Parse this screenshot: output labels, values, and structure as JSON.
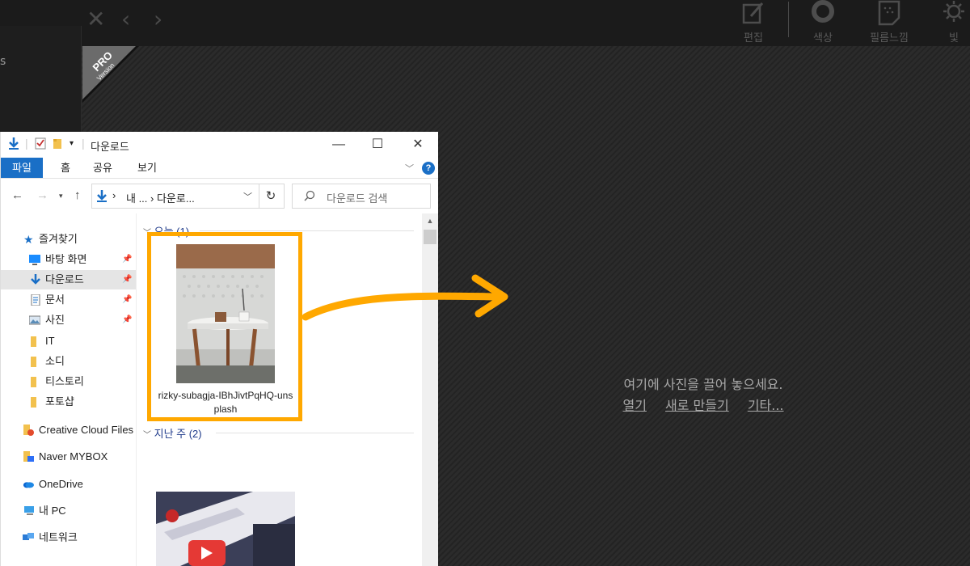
{
  "editor": {
    "tools": [
      {
        "icon": "edit-icon",
        "label": "편집"
      },
      {
        "icon": "color-icon",
        "label": "색상"
      },
      {
        "icon": "film-grain-icon",
        "label": "필름느낌"
      },
      {
        "icon": "light-icon",
        "label": "빛"
      }
    ],
    "left_panel_fragment": "s",
    "pro_badge": {
      "line1": "PRO",
      "line2": "Version"
    },
    "drop_hint": "여기에 사진을 끌어 놓으세요.",
    "links": {
      "open": "열기",
      "new": "새로 만들기",
      "more": "기타..."
    }
  },
  "explorer": {
    "title": "다운로드",
    "ribbon_tabs": [
      "파일",
      "홈",
      "공유",
      "보기"
    ],
    "help": "?",
    "address": "내 ... › 다운로...",
    "address_prefix": "›",
    "search_placeholder": "다운로드 검색",
    "nav": [
      {
        "label": "즐겨찾기",
        "icon": "star-icon"
      },
      {
        "label": "바탕 화면",
        "icon": "desktop-icon",
        "pinned": true
      },
      {
        "label": "다운로드",
        "icon": "download-icon",
        "pinned": true,
        "selected": true
      },
      {
        "label": "문서",
        "icon": "document-icon",
        "pinned": true
      },
      {
        "label": "사진",
        "icon": "pictures-icon",
        "pinned": true
      },
      {
        "label": "IT",
        "icon": "folder-icon"
      },
      {
        "label": "소디",
        "icon": "folder-icon"
      },
      {
        "label": "티스토리",
        "icon": "folder-icon"
      },
      {
        "label": "포토샵",
        "icon": "folder-icon"
      },
      {
        "label": "Creative Cloud Files",
        "icon": "creative-cloud-folder-icon"
      },
      {
        "label": "Naver MYBOX",
        "icon": "mybox-folder-icon"
      },
      {
        "label": "OneDrive",
        "icon": "onedrive-icon"
      },
      {
        "label": "내 PC",
        "icon": "pc-icon"
      },
      {
        "label": "네트워크",
        "icon": "network-icon"
      }
    ],
    "groups": [
      {
        "label": "오늘 (1)"
      },
      {
        "label": "지난 주 (2)"
      }
    ],
    "files": [
      {
        "name_line1": "rizky-subagja-IBhJivtPqHQ-uns",
        "name_line2": "plash"
      }
    ]
  },
  "colors": {
    "highlight": "#ffa800",
    "accent": "#1a6fc6"
  }
}
